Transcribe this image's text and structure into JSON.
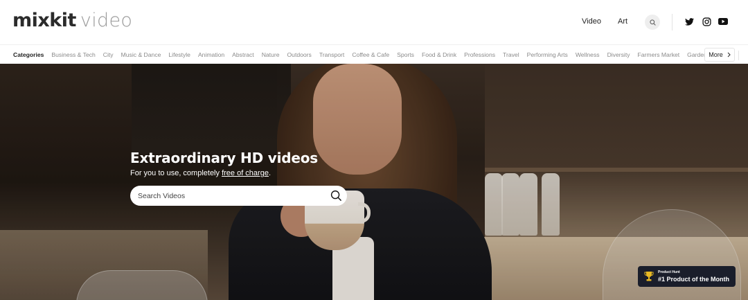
{
  "header": {
    "logo_main": "mixkit",
    "logo_sub": "video",
    "nav": [
      {
        "label": "Video"
      },
      {
        "label": "Art"
      }
    ],
    "icons": {
      "search": "search-icon",
      "twitter": "twitter-icon",
      "instagram": "instagram-icon",
      "youtube": "youtube-icon"
    }
  },
  "categories": {
    "items": [
      {
        "label": "Categories",
        "active": true
      },
      {
        "label": "Business & Tech"
      },
      {
        "label": "City"
      },
      {
        "label": "Music & Dance"
      },
      {
        "label": "Lifestyle"
      },
      {
        "label": "Animation"
      },
      {
        "label": "Abstract"
      },
      {
        "label": "Nature"
      },
      {
        "label": "Outdoors"
      },
      {
        "label": "Transport"
      },
      {
        "label": "Coffee & Cafe"
      },
      {
        "label": "Sports"
      },
      {
        "label": "Food & Drink"
      },
      {
        "label": "Professions"
      },
      {
        "label": "Travel"
      },
      {
        "label": "Performing Arts"
      },
      {
        "label": "Wellness"
      },
      {
        "label": "Diversity"
      },
      {
        "label": "Farmers Market"
      },
      {
        "label": "Gardening"
      }
    ],
    "more_label": "More"
  },
  "hero": {
    "title": "Extraordinary HD videos",
    "subtitle_prefix": "For you to use, completely ",
    "subtitle_link": "free of charge",
    "subtitle_suffix": ".",
    "search_placeholder": "Search Videos"
  },
  "badge": {
    "small": "Product Hunt",
    "big": "#1 Product of the Month"
  },
  "colors": {
    "badge_bg": "#1a1e2b",
    "trophy": "#e8b923"
  }
}
